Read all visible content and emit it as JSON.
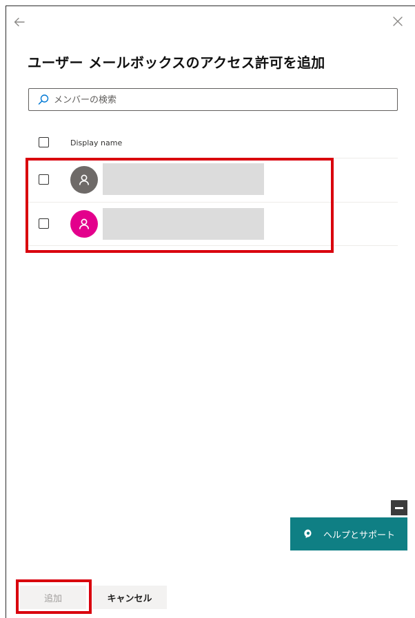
{
  "panel": {
    "title": "ユーザー メールボックスのアクセス許可を追加",
    "back_icon": "arrow-left-icon",
    "close_icon": "close-icon"
  },
  "search": {
    "placeholder": "メンバーの検索",
    "value": "",
    "icon": "search-icon"
  },
  "table": {
    "columns": [
      "Display name"
    ],
    "rows": [
      {
        "display_name": "",
        "avatar_color": "#6e6a68",
        "selected": false
      },
      {
        "display_name": "",
        "avatar_color": "#e3008c",
        "selected": false
      }
    ]
  },
  "help": {
    "label": "ヘルプとサポート",
    "icon": "help-support-icon",
    "color": "#0f7f84"
  },
  "footer": {
    "add_label": "追加",
    "cancel_label": "キャンセル"
  },
  "highlight_color": "#d9000d"
}
